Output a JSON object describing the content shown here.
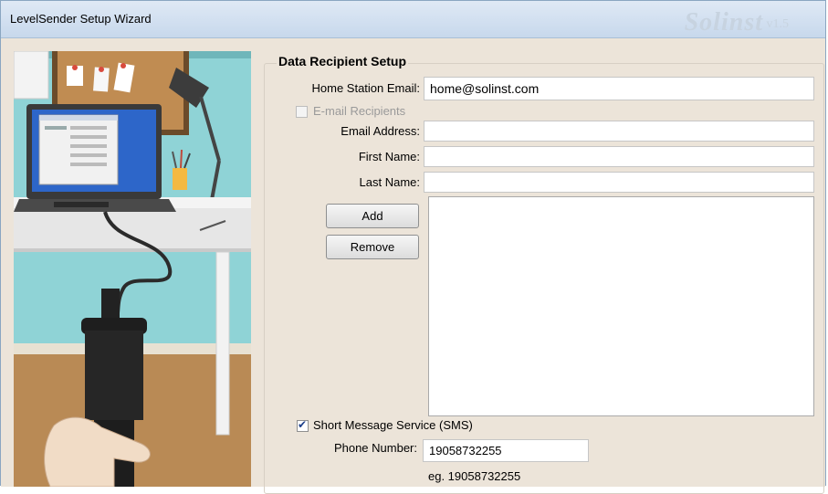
{
  "window": {
    "title": "LevelSender Setup Wizard",
    "brand": "Solinst",
    "brand_version": "v1.5"
  },
  "group": {
    "title": "Data Recipient Setup"
  },
  "home_station": {
    "label": "Home Station Email:",
    "value": "home@solinst.com"
  },
  "email_recipients": {
    "label": "E-mail Recipients",
    "checked": false,
    "enabled": false
  },
  "fields": {
    "email_address_label": "Email Address:",
    "first_name_label": "First Name:",
    "last_name_label": "Last Name:",
    "email_address_value": "",
    "first_name_value": "",
    "last_name_value": ""
  },
  "buttons": {
    "add": "Add",
    "remove": "Remove"
  },
  "sms": {
    "label": "Short Message Service (SMS)",
    "checked": true,
    "phone_label": "Phone Number:",
    "phone_value": "19058732255",
    "example": "eg. 19058732255"
  },
  "icons": {
    "checkmark": "check-icon",
    "illustration": "levelsender-illustration"
  },
  "colors": {
    "window_bg": "#ece4d9",
    "title_gradient_top": "#dfe9f5",
    "check_color": "#1d3f8a"
  }
}
